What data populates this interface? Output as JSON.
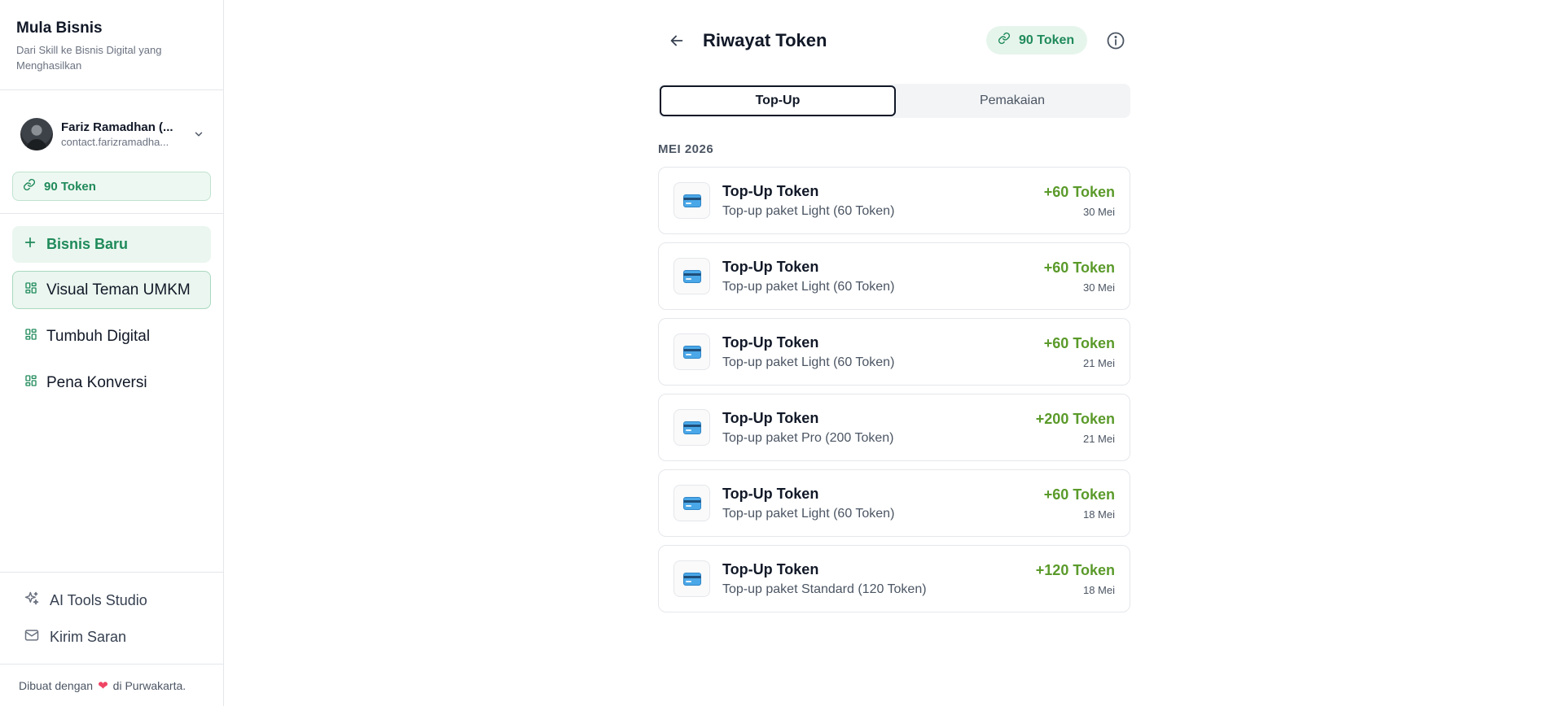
{
  "sidebar": {
    "brand_title": "Mula Bisnis",
    "brand_tagline": "Dari Skill ke Bisnis Digital yang Menghasilkan",
    "user_name": "Fariz Ramadhan (...",
    "user_email": "contact.farizramadha...",
    "token_balance": "90 Token",
    "new_business_label": "Bisnis Baru",
    "projects": [
      {
        "label": "Visual Teman UMKM",
        "active": true
      },
      {
        "label": "Tumbuh Digital",
        "active": false
      },
      {
        "label": "Pena Konversi",
        "active": false
      }
    ],
    "ai_tools_label": "AI Tools Studio",
    "feedback_label": "Kirim Saran",
    "footer_prefix": "Dibuat dengan",
    "footer_suffix": "di Purwakarta."
  },
  "header": {
    "title": "Riwayat Token",
    "token_balance": "90 Token"
  },
  "tabs": [
    {
      "label": "Top-Up",
      "active": true
    },
    {
      "label": "Pemakaian",
      "active": false
    }
  ],
  "month_label": "MEI 2026",
  "transactions": [
    {
      "title": "Top-Up Token",
      "subtitle": "Top-up paket Light (60 Token)",
      "amount": "+60 Token",
      "date": "30 Mei"
    },
    {
      "title": "Top-Up Token",
      "subtitle": "Top-up paket Light (60 Token)",
      "amount": "+60 Token",
      "date": "30 Mei"
    },
    {
      "title": "Top-Up Token",
      "subtitle": "Top-up paket Light (60 Token)",
      "amount": "+60 Token",
      "date": "21 Mei"
    },
    {
      "title": "Top-Up Token",
      "subtitle": "Top-up paket Pro (200 Token)",
      "amount": "+200 Token",
      "date": "21 Mei"
    },
    {
      "title": "Top-Up Token",
      "subtitle": "Top-up paket Light (60 Token)",
      "amount": "+60 Token",
      "date": "18 Mei"
    },
    {
      "title": "Top-Up Token",
      "subtitle": "Top-up paket Standard (120 Token)",
      "amount": "+120 Token",
      "date": "18 Mei"
    }
  ],
  "colors": {
    "accent_green": "#1f8a5a",
    "amount_green": "#5a9a2a",
    "heart": "#ef4463"
  },
  "icons": {
    "token": "link-chain-icon",
    "card": "credit-card-icon",
    "back": "arrow-left-icon",
    "info": "info-circle-icon",
    "project": "grid-layout-icon",
    "ai": "sparkles-icon",
    "mail": "mail-icon"
  }
}
